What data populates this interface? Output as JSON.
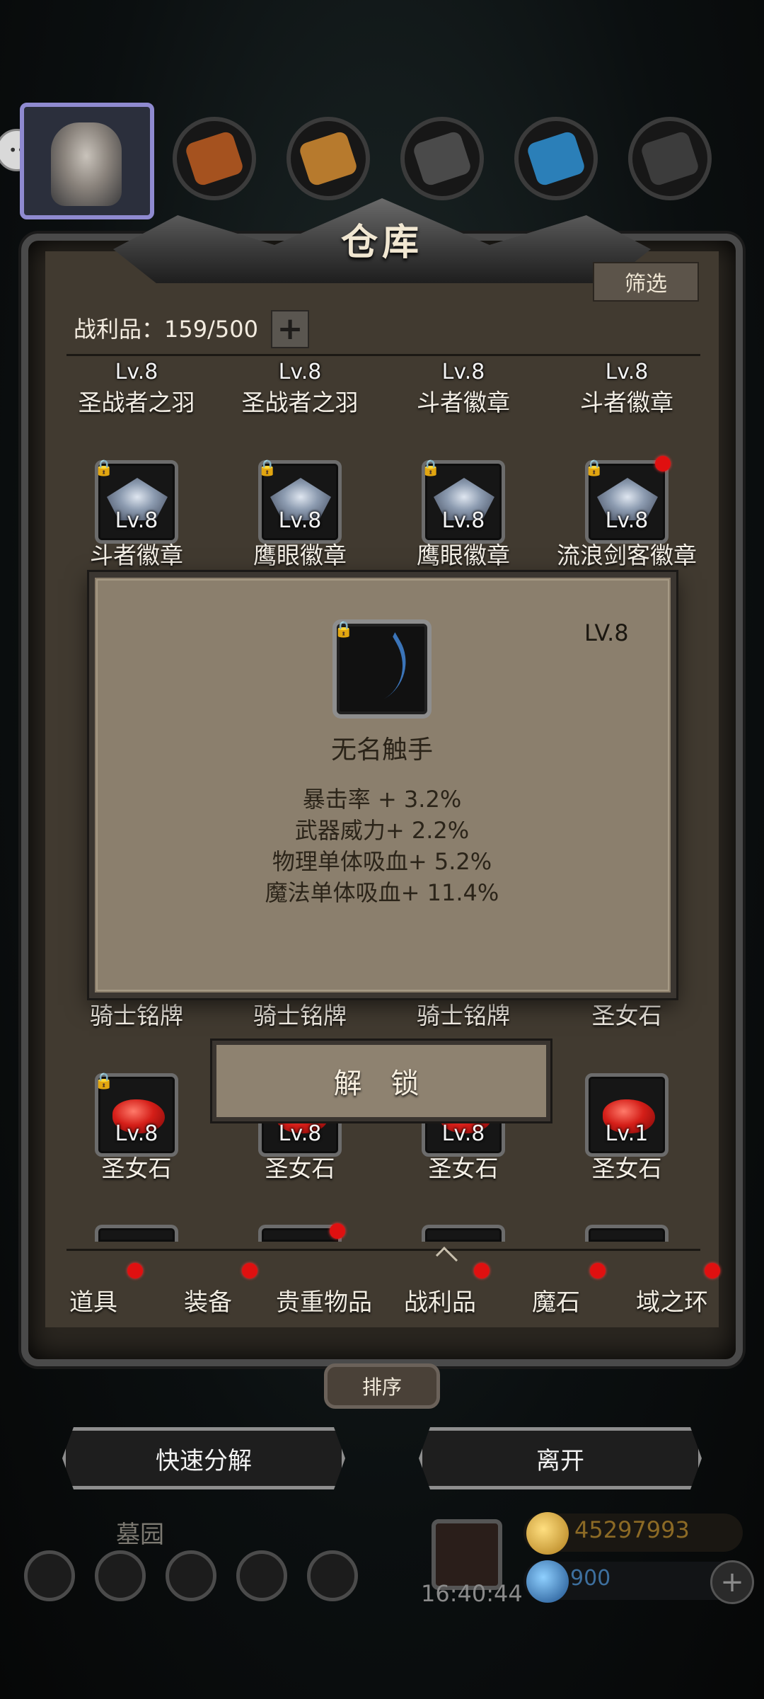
{
  "panel": {
    "title": "仓库",
    "filter_label": "筛选",
    "count_label": "战利品：159/500",
    "plus_label": "+"
  },
  "grid": {
    "row1": [
      {
        "level": "Lv.8",
        "name": "圣战者之羽"
      },
      {
        "level": "Lv.8",
        "name": "圣战者之羽"
      },
      {
        "level": "Lv.8",
        "name": "斗者徽章"
      },
      {
        "level": "Lv.8",
        "name": "斗者徽章"
      }
    ],
    "row2": [
      {
        "level": "Lv.8",
        "name": "斗者徽章"
      },
      {
        "level": "Lv.8",
        "name": "鹰眼徽章"
      },
      {
        "level": "Lv.8",
        "name": "鹰眼徽章"
      },
      {
        "level": "Lv.8",
        "name": "流浪剑客徽章"
      }
    ],
    "row3_names": [
      "骑士铭牌",
      "骑士铭牌",
      "骑士铭牌",
      "圣女石"
    ],
    "row4": [
      {
        "level": "Lv.8",
        "name": "圣女石"
      },
      {
        "level": "Lv.8",
        "name": "圣女石"
      },
      {
        "level": "Lv.8",
        "name": "圣女石"
      },
      {
        "level": "Lv.1",
        "name": "圣女石"
      }
    ]
  },
  "popup": {
    "level": "LV.8",
    "item_name": "无名触手",
    "stats": [
      "暴击率 + 3.2%",
      "武器威力+ 2.2%",
      "物理单体吸血+ 5.2%",
      "魔法单体吸血+ 11.4%"
    ],
    "unlock_label": "解 锁"
  },
  "tabs": [
    "道具",
    "装备",
    "贵重物品",
    "战利品",
    "魔石",
    "域之环"
  ],
  "sort_label": "排序",
  "actions": {
    "quick_decompose": "快速分解",
    "leave": "离开"
  },
  "bottom": {
    "location": "墓园",
    "timer": "16:40:44",
    "gold": "45297993",
    "gems": "900"
  },
  "icons": [
    "chat-icon",
    "avatar",
    "resource-meat-icon",
    "resource-wood-icon",
    "resource-stone-icon",
    "resource-crystal-icon",
    "resource-ore-icon",
    "lock-icon",
    "gift-icon",
    "gold-icon",
    "gem-icon",
    "add-icon"
  ],
  "colors": {
    "panel_bg": "#413a30",
    "popup_bg": "#8b7f6d",
    "notification_dot": "#e01010"
  }
}
